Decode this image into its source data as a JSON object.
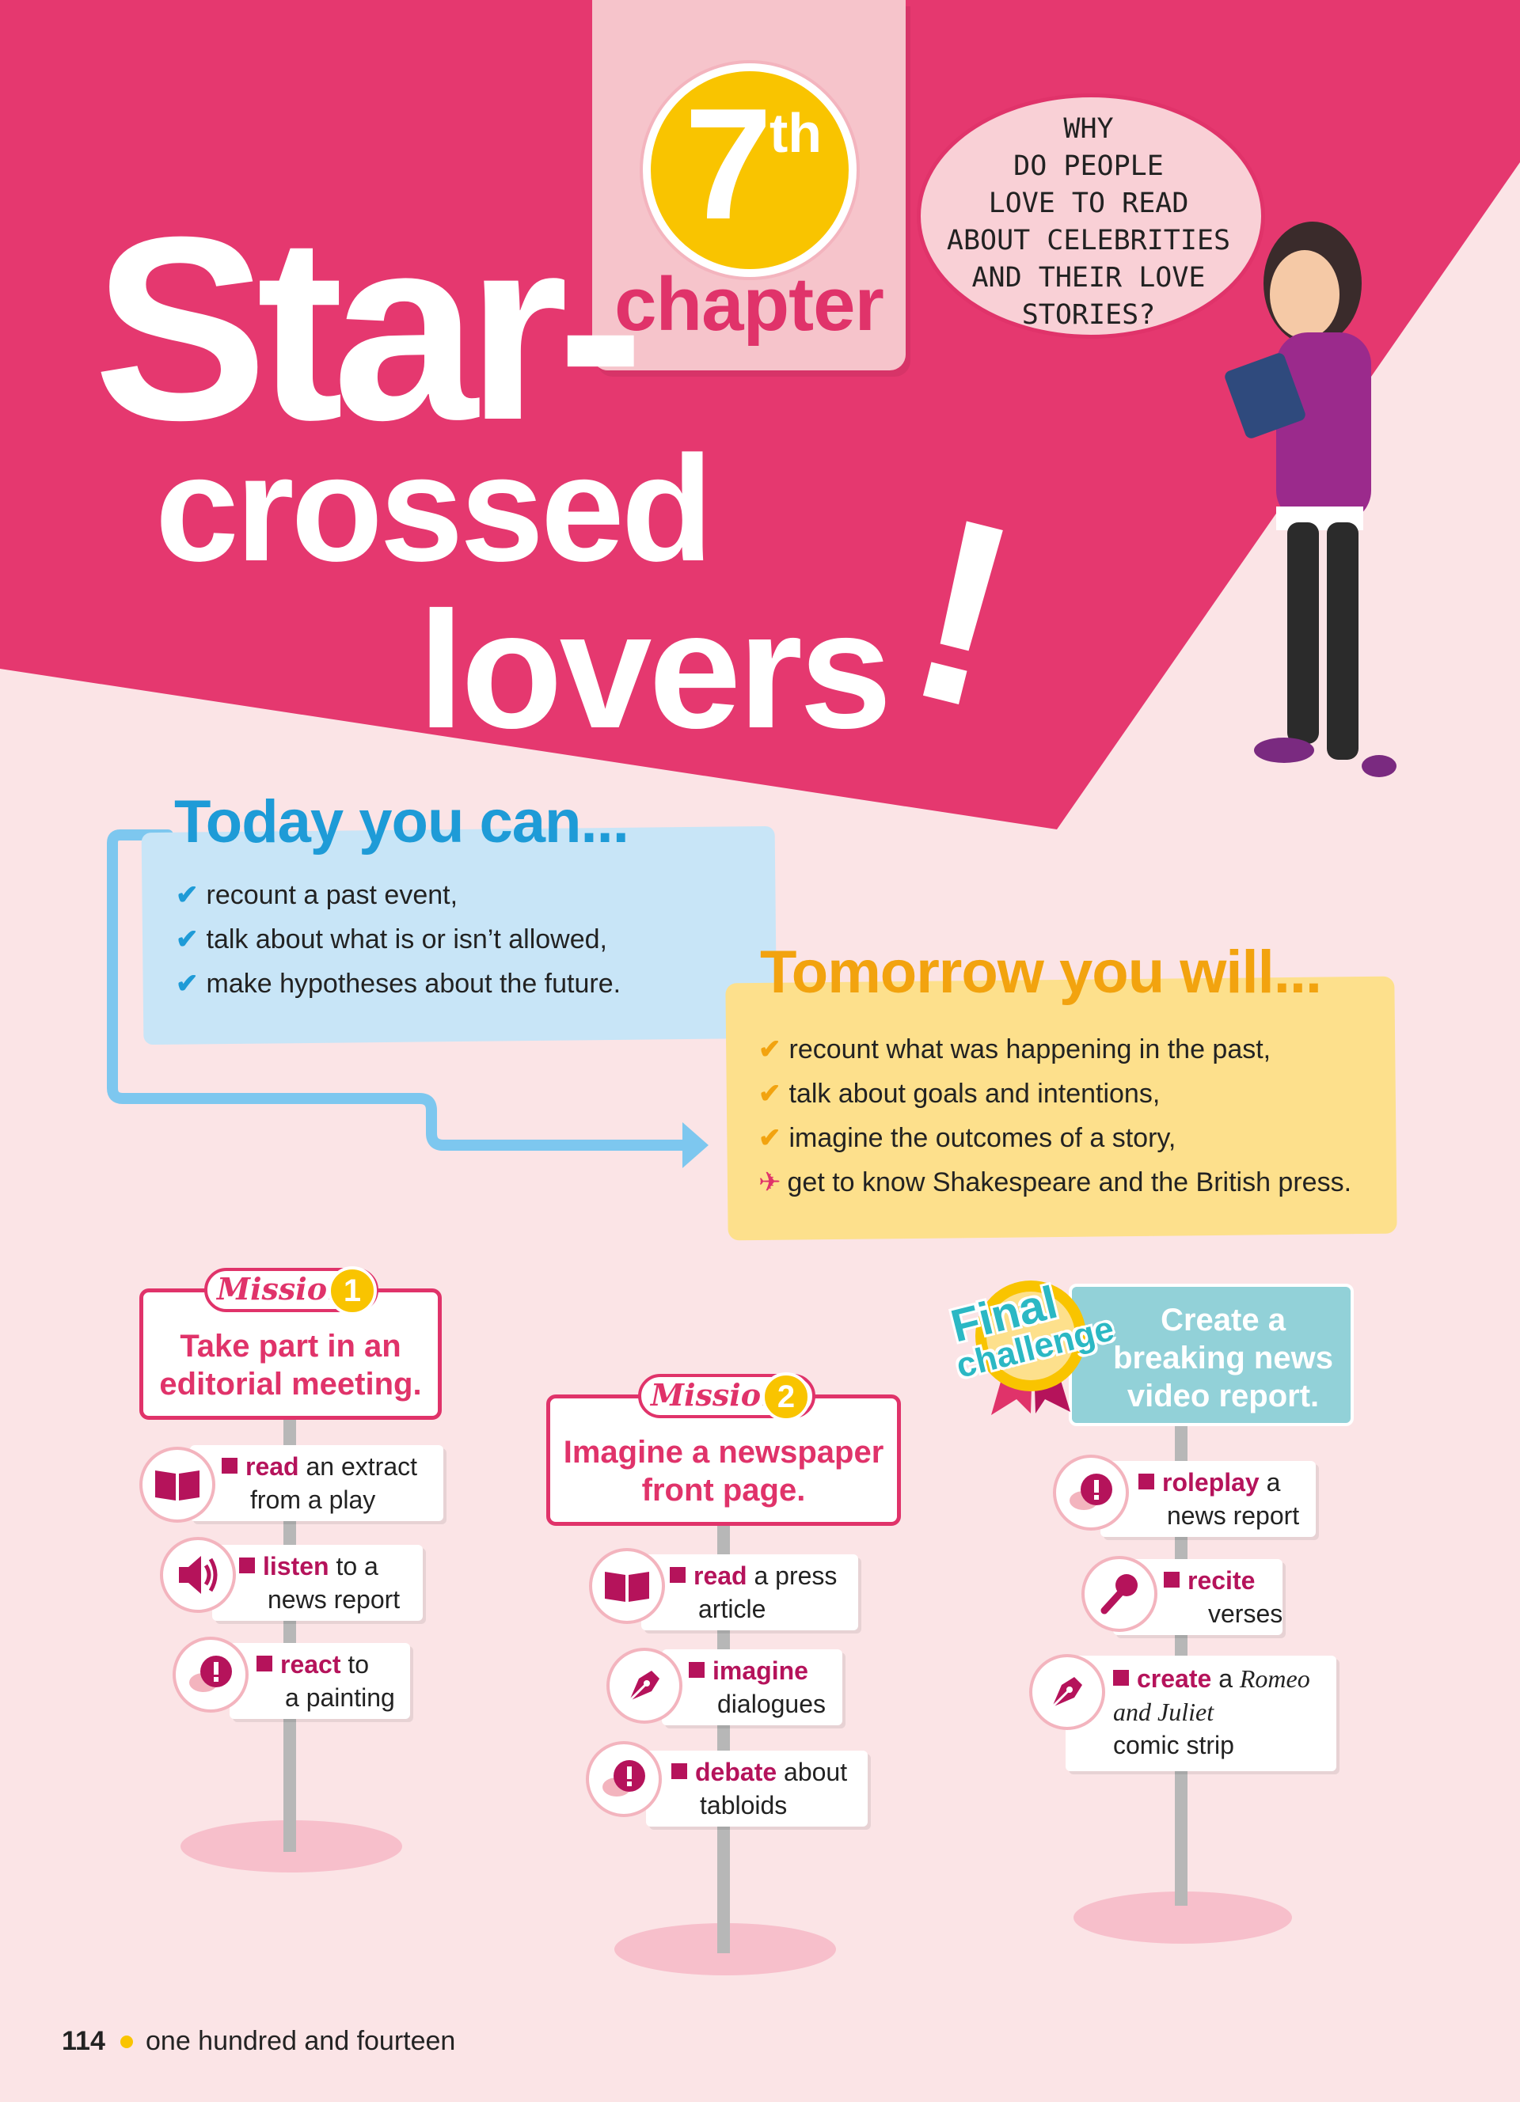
{
  "chapter": {
    "number": "7",
    "suffix": "th",
    "word": "chapter"
  },
  "title": {
    "line1": "Star-",
    "line2": "crossed",
    "line3": "lovers",
    "mark": "!"
  },
  "speech_bubble": [
    "WHY",
    "DO PEOPLE",
    "LOVE TO READ",
    "ABOUT CELEBRITIES",
    "AND THEIR LOVE",
    "STORIES?"
  ],
  "today": {
    "heading": "Today you can...",
    "items": [
      "recount a past event,",
      "talk about what is or isn’t allowed,",
      "make hypotheses about the future."
    ]
  },
  "tomorrow": {
    "heading": "Tomorrow you will...",
    "items": [
      "recount what was happening in the past,",
      "talk about goals and intentions,",
      "imagine the outcomes of a story,",
      "get to know Shakespeare and the British press."
    ]
  },
  "mission1": {
    "tag": "Mission",
    "number": "1",
    "title_line1": "Take part in an",
    "title_line2": "editorial meeting.",
    "signs": [
      {
        "verb": "read",
        "rest1": " an extract",
        "rest2": "from a play",
        "icon": "book-icon"
      },
      {
        "verb": "listen",
        "rest1": " to a",
        "rest2": "news report",
        "icon": "speaker-icon"
      },
      {
        "verb": "react",
        "rest1": " to",
        "rest2": "a painting",
        "icon": "speech-exclamation-icon"
      }
    ]
  },
  "mission2": {
    "tag": "Mission",
    "number": "2",
    "title_line1": "Imagine a newspaper",
    "title_line2": "front page.",
    "signs": [
      {
        "verb": "read",
        "rest1": " a press",
        "rest2": "article",
        "icon": "book-icon"
      },
      {
        "verb": "imagine",
        "rest1": "",
        "rest2": "dialogues",
        "icon": "pen-nib-icon"
      },
      {
        "verb": "debate",
        "rest1": " about",
        "rest2": "tabloids",
        "icon": "speech-exclamation-icon"
      }
    ]
  },
  "final": {
    "badge_line1": "Final",
    "badge_line2": "challenge",
    "title_line1": "Create a",
    "title_line2": "breaking news",
    "title_line3": "video report.",
    "signs": [
      {
        "verb": "roleplay",
        "rest1": " a",
        "rest2": "news report",
        "icon": "speech-exclamation-icon"
      },
      {
        "verb": "recite",
        "rest1": "",
        "rest2": "verses",
        "icon": "microphone-icon"
      },
      {
        "verb": "create",
        "rest1": " a ",
        "italic": "Romeo",
        "rest2_italic": "and Juliet",
        "rest3": "comic strip",
        "icon": "pen-nib-icon"
      }
    ]
  },
  "footer": {
    "page_number": "114",
    "page_words": "one hundred and fourteen"
  },
  "colors": {
    "pink": "#e0336a",
    "blue": "#1e9bd7",
    "orange": "#f2a30f",
    "yellow": "#f9c400",
    "teal": "#92d1d8"
  }
}
